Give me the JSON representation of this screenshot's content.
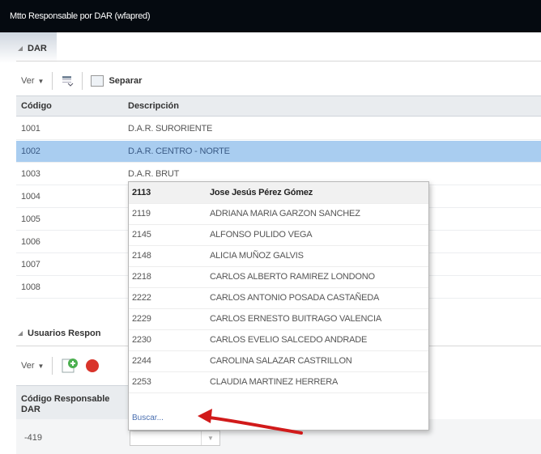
{
  "window": {
    "title": "Mtto Responsable por DAR (wfapred)"
  },
  "dar_section": {
    "title": "DAR",
    "toolbar": {
      "view_label": "Ver",
      "split_label": "Separar"
    },
    "columns": [
      "Código",
      "Descripción"
    ],
    "rows": [
      {
        "code": "1001",
        "desc": "D.A.R. SURORIENTE"
      },
      {
        "code": "1002",
        "desc": "D.A.R. CENTRO - NORTE",
        "selected": true
      },
      {
        "code": "1003",
        "desc": "D.A.R. BRUT"
      },
      {
        "code": "1004",
        "desc": ""
      },
      {
        "code": "1005",
        "desc": ""
      },
      {
        "code": "1006",
        "desc": ""
      },
      {
        "code": "1007",
        "desc": ""
      },
      {
        "code": "1008",
        "desc": ""
      }
    ]
  },
  "users_section": {
    "title": "Usuarios Respon",
    "toolbar": {
      "view_label": "Ver"
    },
    "columns": [
      "Código Responsable DAR"
    ],
    "row": {
      "code": "-419"
    }
  },
  "popup": {
    "items": [
      {
        "code": "2113",
        "name": "Jose Jesús Pérez Gómez",
        "highlighted": true
      },
      {
        "code": "2119",
        "name": "ADRIANA MARIA GARZON SANCHEZ"
      },
      {
        "code": "2145",
        "name": "ALFONSO PULIDO VEGA"
      },
      {
        "code": "2148",
        "name": "ALICIA MUÑOZ GALVIS"
      },
      {
        "code": "2218",
        "name": "CARLOS ALBERTO RAMIREZ LONDONO"
      },
      {
        "code": "2222",
        "name": "CARLOS ANTONIO POSADA CASTAÑEDA"
      },
      {
        "code": "2229",
        "name": "CARLOS ERNESTO BUITRAGO VALENCIA"
      },
      {
        "code": "2230",
        "name": "CARLOS EVELIO SALCEDO ANDRADE"
      },
      {
        "code": "2244",
        "name": "CAROLINA SALAZAR CASTRILLON"
      },
      {
        "code": "2253",
        "name": "CLAUDIA MARTINEZ HERRERA"
      }
    ],
    "search_link": "Buscar..."
  },
  "colors": {
    "selected_row": "#a9cdf0",
    "titlebar": "#050a10",
    "arrow": "#d11a1a",
    "link": "#4a6fb0"
  }
}
